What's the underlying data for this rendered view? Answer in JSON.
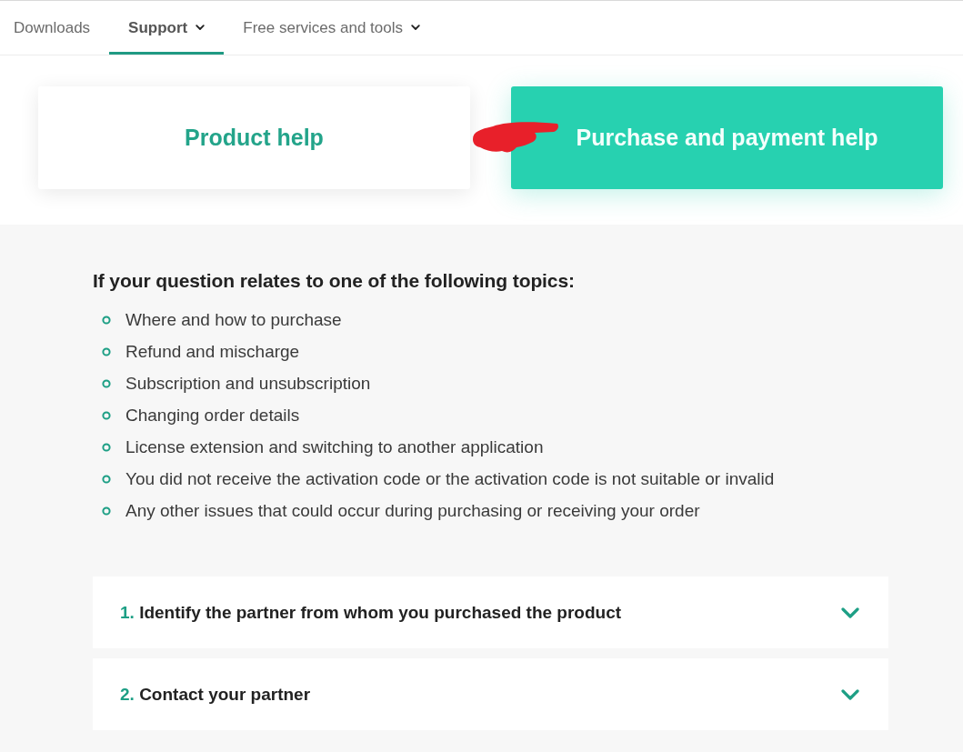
{
  "nav": {
    "tabs": [
      {
        "label": "Downloads",
        "selected": false,
        "dropdown": false
      },
      {
        "label": "Support",
        "selected": true,
        "dropdown": true
      },
      {
        "label": "Free services and tools",
        "selected": false,
        "dropdown": true
      }
    ]
  },
  "help_cards": [
    {
      "label": "Product help",
      "selected": false
    },
    {
      "label": "Purchase and payment help",
      "selected": true
    }
  ],
  "topics": {
    "heading": "If your question relates to one of the following topics:",
    "items": [
      "Where and how to purchase",
      "Refund and mischarge",
      "Subscription and unsubscription",
      "Changing order details",
      "License extension and switching to another application",
      "You did not receive the activation code or the activation code is not suitable or invalid",
      "Any other issues that could occur during purchasing or receiving your order"
    ]
  },
  "steps": [
    {
      "number": "1.",
      "title": "Identify the partner from whom you purchased the product",
      "expanded": false
    },
    {
      "number": "2.",
      "title": "Contact your partner",
      "expanded": false
    }
  ]
}
